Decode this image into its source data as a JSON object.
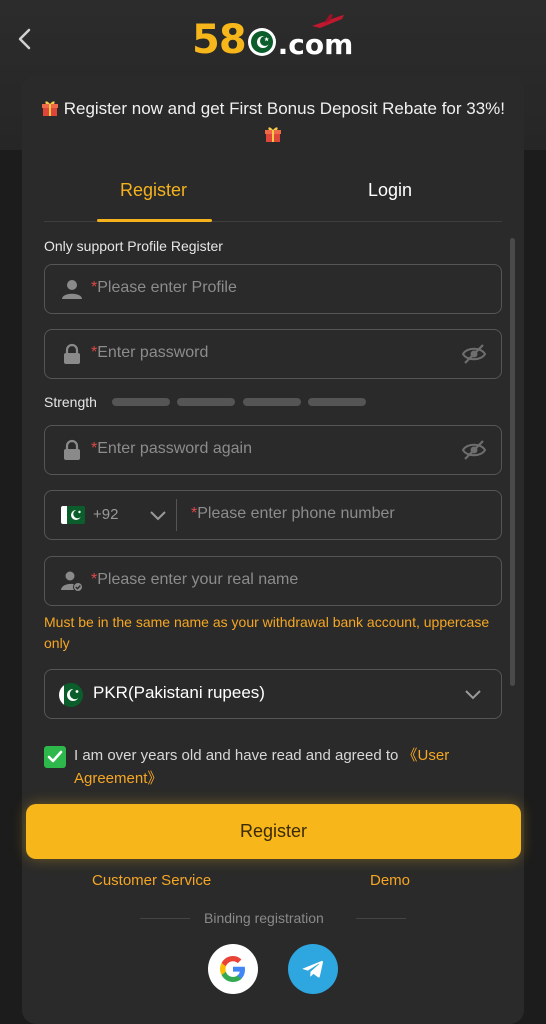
{
  "header": {
    "logo_num": "58",
    "logo_suffix": ".com"
  },
  "promo": {
    "text": "Register now and get First Bonus Deposit Rebate for 33%!"
  },
  "tabs": [
    {
      "label": "Register",
      "active": true
    },
    {
      "label": "Login",
      "active": false
    }
  ],
  "form": {
    "support_note": "Only support Profile Register",
    "required_mark": "*",
    "profile_placeholder": "Please enter Profile",
    "password_placeholder": "Enter password",
    "strength_label": "Strength",
    "password_again_placeholder": "Enter password again",
    "phone_code": "+92",
    "phone_placeholder": "Please enter phone number",
    "real_name_placeholder": "Please enter your real name",
    "name_warning": "Must be in the same name as your withdrawal bank account, uppercase only",
    "currency": "PKR(Pakistani rupees)",
    "agreement_text": "I am over years old and have read and agreed to ",
    "agreement_link": "《User Agreement》",
    "agreement_checked": true
  },
  "actions": {
    "register_label": "Register",
    "customer_service": "Customer Service",
    "demo": "Demo",
    "binding_label": "Binding registration"
  },
  "social": [
    {
      "name": "google-icon"
    },
    {
      "name": "telegram-icon"
    }
  ],
  "colors": {
    "accent": "#f7b61a",
    "link": "#f5a623",
    "background": "#1c1c1c",
    "card": "#2a2a2a",
    "checkbox": "#2eb84b",
    "required": "#e04848"
  }
}
